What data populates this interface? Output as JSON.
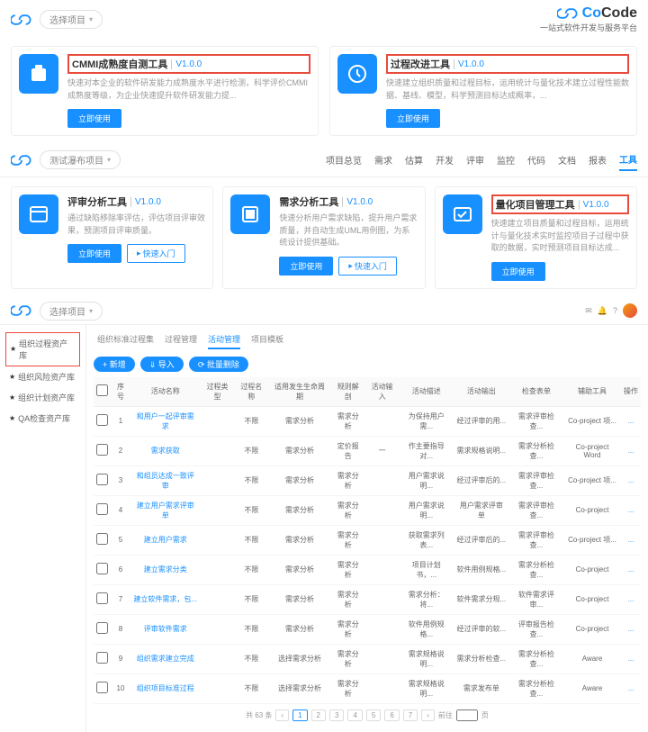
{
  "brand": {
    "name1": "Co",
    "name2": "Code",
    "sub": "一站式软件开发与服务平台"
  },
  "topDropdown": "选择项目",
  "section1": {
    "cards": [
      {
        "title": "CMMI成熟度自测工具",
        "version": "V1.0.0",
        "desc": "快速对本企业的软件研发能力成熟度水平进行检测，科学评价CMMI成熟度等级，为企业快速提升软件研发能力提...",
        "btn": "立即使用",
        "highlight": true
      },
      {
        "title": "过程改进工具",
        "version": "V1.0.0",
        "desc": "快速建立组织质量和过程目标，运用统计与量化技术建立过程性能数据、基线、模型，科学预测目标达成概率，...",
        "btn": "立即使用",
        "highlight": true
      }
    ]
  },
  "section2": {
    "dropdown": "测试瀑布项目",
    "tabs": [
      "项目总览",
      "需求",
      "估算",
      "开发",
      "评审",
      "监控",
      "代码",
      "文档",
      "报表",
      "工具"
    ],
    "activeTab": 9,
    "cards": [
      {
        "title": "评审分析工具",
        "version": "V1.0.0",
        "desc": "通过缺陷移除率评估，评估项目评审效果，预测项目评审质量。",
        "btn": "立即使用",
        "btn2": "快速入门",
        "highlight": false
      },
      {
        "title": "需求分析工具",
        "version": "V1.0.0",
        "desc": "快速分析用户需求缺陷，提升用户需求质量，并自动生成UML用例图，为系统设计提供基础。",
        "btn": "立即使用",
        "btn2": "快速入门",
        "highlight": false
      },
      {
        "title": "量化项目管理工具",
        "version": "V1.0.0",
        "desc": "快速建立项目质量和过程目标，运用统计与量化技术实时监控项目子过程中获取的数据，实时预测项目目标达成...",
        "btn": "立即使用",
        "highlight": true
      }
    ]
  },
  "section3": {
    "dropdown": "选择项目",
    "sidebar": [
      {
        "label": "组织过程资产库",
        "boxed": true,
        "star": true
      },
      {
        "label": "组织风险资产库",
        "star": true
      },
      {
        "label": "组织计划资产库",
        "star": true
      },
      {
        "label": "QA检查资产库",
        "star": true
      }
    ],
    "subTabs": [
      "组织标准过程集",
      "过程管理",
      "活动管理",
      "项目模板"
    ],
    "activeSub": 2,
    "toolbar": [
      "+ 新增",
      "⇓ 导入",
      "⟳ 批量删除"
    ],
    "columns": [
      "",
      "序号",
      "活动名称",
      "过程类型",
      "过程名称",
      "适用发生生命周期",
      "规则解剖",
      "活动输入",
      "活动描述",
      "活动输出",
      "检查表单",
      "辅助工具",
      "操作"
    ],
    "rows": [
      [
        "1",
        "和用户一起评审需求",
        "",
        "不限",
        "需求分析",
        "需求分析",
        "",
        "为保持用户需...",
        "经过评审的用...",
        "需求评审检查...",
        "Co-project 项..."
      ],
      [
        "2",
        "需求获取",
        "",
        "不限",
        "需求分析",
        "定价报告",
        "一",
        "作主要指导对...",
        "需求规格说明...",
        "需求分析检查...",
        "Co-project Word"
      ],
      [
        "3",
        "和组员达成一致评审",
        "",
        "不限",
        "需求分析",
        "需求分析",
        "",
        "用户需求说明...",
        "经过评审后的...",
        "需求评审检查...",
        "Co-project 项..."
      ],
      [
        "4",
        "建立用户需求评审单",
        "",
        "不限",
        "需求分析",
        "需求分析",
        "",
        "用户需求说明...",
        "用户需求评审单",
        "需求评审检查...",
        "Co-project"
      ],
      [
        "5",
        "建立用户需求",
        "",
        "不限",
        "需求分析",
        "需求分析",
        "",
        "获取需求列表...",
        "经过评审后的...",
        "需求评审检查...",
        "Co-project 项..."
      ],
      [
        "6",
        "建立需求分类",
        "",
        "不限",
        "需求分析",
        "需求分析",
        "",
        "项目计划书，...",
        "软件用例规格...",
        "需求分析检查...",
        "Co-project"
      ],
      [
        "7",
        "建立软件需求，包...",
        "",
        "不限",
        "需求分析",
        "需求分析",
        "",
        "需求分析：将...",
        "软件需求分规...",
        "软件需求评审...",
        "Co-project"
      ],
      [
        "8",
        "评审软件需求",
        "",
        "不限",
        "需求分析",
        "需求分析",
        "",
        "软件用例规格...",
        "经过评审的软...",
        "评审报告检查...",
        "Co-project"
      ],
      [
        "9",
        "组织需求建立完成",
        "",
        "不限",
        "选择需求分析",
        "需求分析",
        "",
        "需求规格说明...",
        "需求分析检查...",
        "需求分析检查...",
        "Aware"
      ],
      [
        "10",
        "组织项目标准过程",
        "",
        "不限",
        "选择需求分析",
        "需求分析",
        "",
        "需求规格说明...",
        "需求发布单",
        "需求分析检查...",
        "Aware"
      ]
    ],
    "pagination": {
      "total": "共 63 条",
      "pages": [
        "1",
        "2",
        "3",
        "4",
        "5",
        "6",
        "7"
      ],
      "active": 0,
      "jump": "前往",
      "page": "页"
    }
  }
}
